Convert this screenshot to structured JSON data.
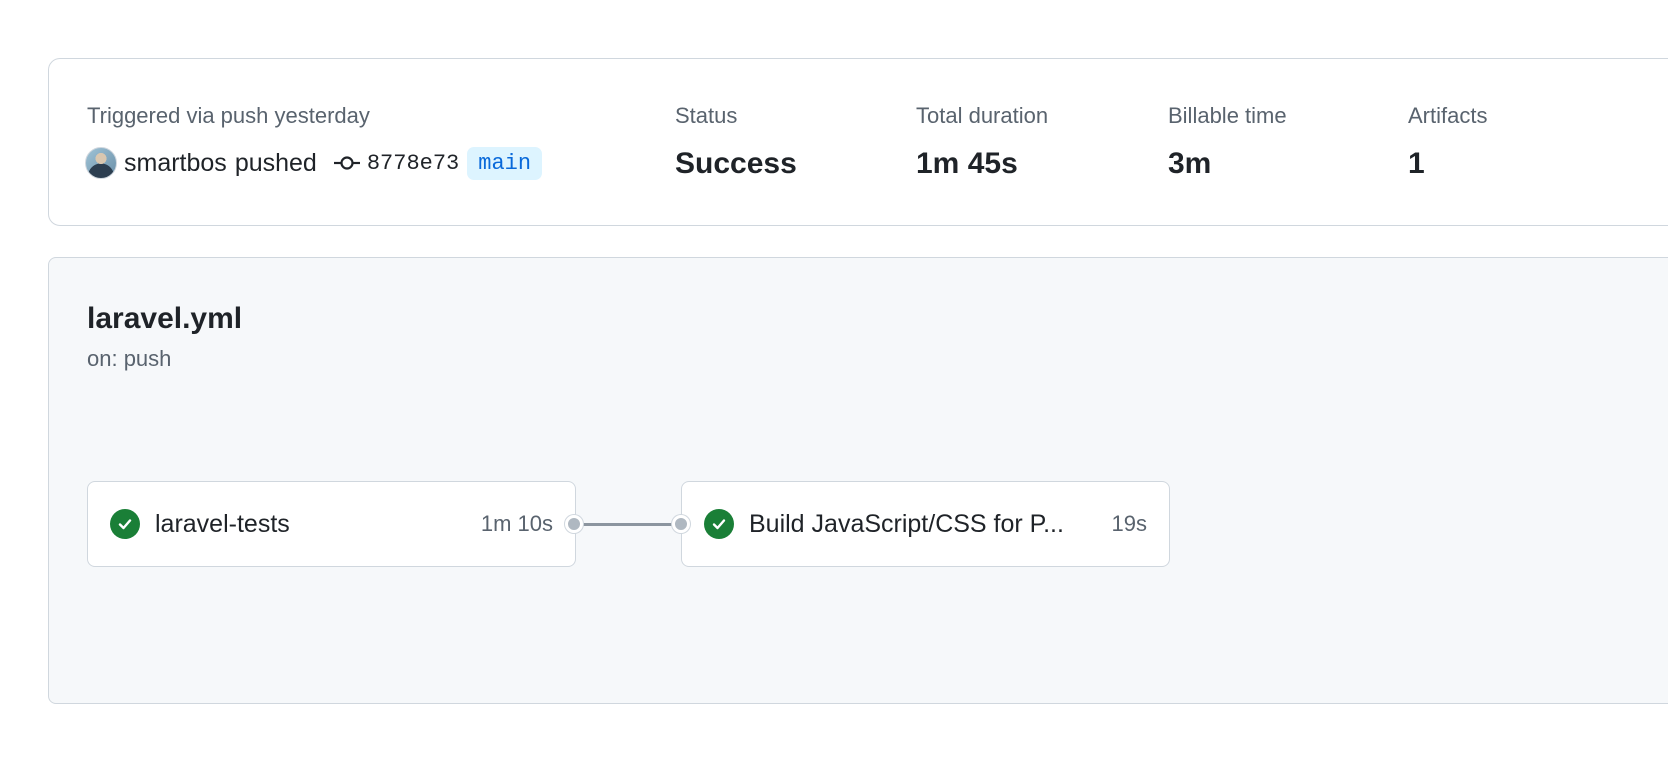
{
  "summary": {
    "trigger_label": "Triggered via push yesterday",
    "actor": "smartbos",
    "action": "pushed",
    "commit_sha": "8778e73",
    "branch": "main",
    "stats": {
      "status_label": "Status",
      "status_value": "Success",
      "duration_label": "Total duration",
      "duration_value": "1m 45s",
      "billable_label": "Billable time",
      "billable_value": "3m",
      "artifacts_label": "Artifacts",
      "artifacts_value": "1"
    }
  },
  "workflow": {
    "file": "laravel.yml",
    "trigger": "on: push",
    "jobs": [
      {
        "name": "laravel-tests",
        "duration": "1m 10s",
        "status": "success",
        "icon": "check-circle-icon"
      },
      {
        "name": "Build JavaScript/CSS for P...",
        "duration": "19s",
        "status": "success",
        "icon": "check-circle-icon"
      }
    ]
  },
  "colors": {
    "success": "#1a7f37",
    "branch_bg": "#ddf4ff",
    "branch_text": "#0969da",
    "panel_bg": "#f6f8fa"
  }
}
